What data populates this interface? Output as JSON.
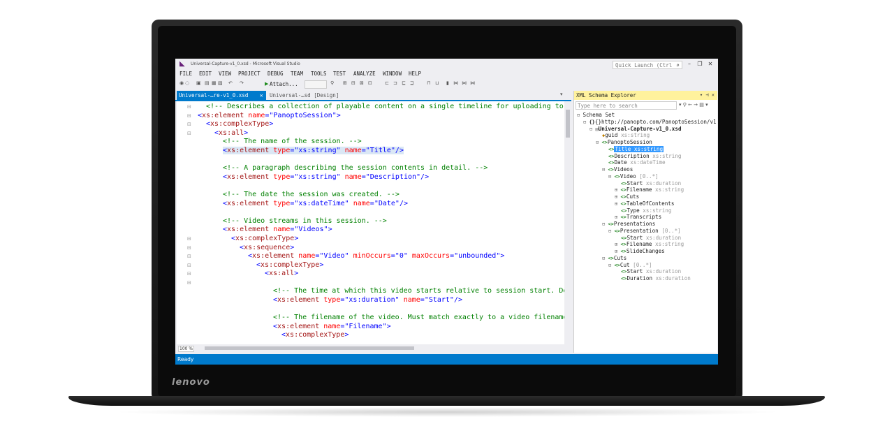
{
  "brand": {
    "logo_text": "lenovo"
  },
  "window": {
    "title": "Universal-Capture-v1_0.xsd - Microsoft Visual Studio",
    "quick_launch_placeholder": "Quick Launch (Ctrl"
  },
  "menu": [
    "FILE",
    "EDIT",
    "VIEW",
    "PROJECT",
    "DEBUG",
    "TEAM",
    "TOOLS",
    "TEST",
    "ANALYZE",
    "WINDOW",
    "HELP"
  ],
  "toolbar": {
    "attach_label": "Attach..."
  },
  "tabs": [
    {
      "label": "Universal-…re-v1_0.xsd",
      "active": true
    },
    {
      "label": "Universal-…sd [Design]",
      "active": false
    }
  ],
  "editor": {
    "zoom": "100 %",
    "lines": [
      {
        "indent": 1,
        "parts": [
          {
            "c": "comment",
            "t": "<!-- Describes a collection of playable content on a single timeline for uploading to a Pa"
          }
        ]
      },
      {
        "indent": 0,
        "parts": [
          {
            "c": "br",
            "t": "<"
          },
          {
            "c": "tag",
            "t": "xs:element"
          },
          {
            "c": "attr",
            "t": " name"
          },
          {
            "c": "br",
            "t": "="
          },
          {
            "c": "val",
            "t": "\"PanoptoSession\""
          },
          {
            "c": "br",
            "t": ">"
          }
        ]
      },
      {
        "indent": 1,
        "parts": [
          {
            "c": "br",
            "t": "<"
          },
          {
            "c": "tag",
            "t": "xs:complexType"
          },
          {
            "c": "br",
            "t": ">"
          }
        ]
      },
      {
        "indent": 2,
        "parts": [
          {
            "c": "br",
            "t": "<"
          },
          {
            "c": "tag",
            "t": "xs:all"
          },
          {
            "c": "br",
            "t": ">"
          }
        ]
      },
      {
        "indent": 3,
        "parts": [
          {
            "c": "comment",
            "t": "<!-- The name of the session. -->"
          }
        ]
      },
      {
        "indent": 3,
        "hl": true,
        "parts": [
          {
            "c": "br",
            "t": "<"
          },
          {
            "c": "tag",
            "t": "xs:element"
          },
          {
            "c": "attr",
            "t": " type"
          },
          {
            "c": "br",
            "t": "="
          },
          {
            "c": "val",
            "t": "\"xs:string\""
          },
          {
            "c": "attr",
            "t": " name"
          },
          {
            "c": "br",
            "t": "="
          },
          {
            "c": "val",
            "t": "\"Title\""
          },
          {
            "c": "br",
            "t": "/>"
          }
        ]
      },
      {
        "indent": 0,
        "parts": []
      },
      {
        "indent": 3,
        "parts": [
          {
            "c": "comment",
            "t": "<!-- A paragraph describing the session contents in detail. -->"
          }
        ]
      },
      {
        "indent": 3,
        "parts": [
          {
            "c": "br",
            "t": "<"
          },
          {
            "c": "tag",
            "t": "xs:element"
          },
          {
            "c": "attr",
            "t": " type"
          },
          {
            "c": "br",
            "t": "="
          },
          {
            "c": "val",
            "t": "\"xs:string\""
          },
          {
            "c": "attr",
            "t": " name"
          },
          {
            "c": "br",
            "t": "="
          },
          {
            "c": "val",
            "t": "\"Description\""
          },
          {
            "c": "br",
            "t": "/>"
          }
        ]
      },
      {
        "indent": 0,
        "parts": []
      },
      {
        "indent": 3,
        "parts": [
          {
            "c": "comment",
            "t": "<!-- The date the session was created. -->"
          }
        ]
      },
      {
        "indent": 3,
        "parts": [
          {
            "c": "br",
            "t": "<"
          },
          {
            "c": "tag",
            "t": "xs:element"
          },
          {
            "c": "attr",
            "t": " type"
          },
          {
            "c": "br",
            "t": "="
          },
          {
            "c": "val",
            "t": "\"xs:dateTime\""
          },
          {
            "c": "attr",
            "t": " name"
          },
          {
            "c": "br",
            "t": "="
          },
          {
            "c": "val",
            "t": "\"Date\""
          },
          {
            "c": "br",
            "t": "/>"
          }
        ]
      },
      {
        "indent": 0,
        "parts": []
      },
      {
        "indent": 3,
        "parts": [
          {
            "c": "comment",
            "t": "<!-- Video streams in this session. -->"
          }
        ]
      },
      {
        "indent": 3,
        "parts": [
          {
            "c": "br",
            "t": "<"
          },
          {
            "c": "tag",
            "t": "xs:element"
          },
          {
            "c": "attr",
            "t": " name"
          },
          {
            "c": "br",
            "t": "="
          },
          {
            "c": "val",
            "t": "\"Videos\""
          },
          {
            "c": "br",
            "t": ">"
          }
        ]
      },
      {
        "indent": 4,
        "parts": [
          {
            "c": "br",
            "t": "<"
          },
          {
            "c": "tag",
            "t": "xs:complexType"
          },
          {
            "c": "br",
            "t": ">"
          }
        ]
      },
      {
        "indent": 5,
        "parts": [
          {
            "c": "br",
            "t": "<"
          },
          {
            "c": "tag",
            "t": "xs:sequence"
          },
          {
            "c": "br",
            "t": ">"
          }
        ]
      },
      {
        "indent": 6,
        "parts": [
          {
            "c": "br",
            "t": "<"
          },
          {
            "c": "tag",
            "t": "xs:element"
          },
          {
            "c": "attr",
            "t": " name"
          },
          {
            "c": "br",
            "t": "="
          },
          {
            "c": "val",
            "t": "\"Video\""
          },
          {
            "c": "attr",
            "t": " minOccurs"
          },
          {
            "c": "br",
            "t": "="
          },
          {
            "c": "val",
            "t": "\"0\""
          },
          {
            "c": "attr",
            "t": " maxOccurs"
          },
          {
            "c": "br",
            "t": "="
          },
          {
            "c": "val",
            "t": "\"unbounded\""
          },
          {
            "c": "br",
            "t": ">"
          }
        ]
      },
      {
        "indent": 7,
        "parts": [
          {
            "c": "br",
            "t": "<"
          },
          {
            "c": "tag",
            "t": "xs:complexType"
          },
          {
            "c": "br",
            "t": ">"
          }
        ]
      },
      {
        "indent": 8,
        "parts": [
          {
            "c": "br",
            "t": "<"
          },
          {
            "c": "tag",
            "t": "xs:all"
          },
          {
            "c": "br",
            "t": ">"
          }
        ]
      },
      {
        "indent": 0,
        "parts": []
      },
      {
        "indent": 9,
        "parts": [
          {
            "c": "comment",
            "t": "<!-- The time at which this video starts relative to session start. Dete"
          }
        ]
      },
      {
        "indent": 9,
        "parts": [
          {
            "c": "br",
            "t": "<"
          },
          {
            "c": "tag",
            "t": "xs:element"
          },
          {
            "c": "attr",
            "t": " type"
          },
          {
            "c": "br",
            "t": "="
          },
          {
            "c": "val",
            "t": "\"xs:duration\""
          },
          {
            "c": "attr",
            "t": " name"
          },
          {
            "c": "br",
            "t": "="
          },
          {
            "c": "val",
            "t": "\"Start\""
          },
          {
            "c": "br",
            "t": "/>"
          }
        ]
      },
      {
        "indent": 0,
        "parts": []
      },
      {
        "indent": 9,
        "parts": [
          {
            "c": "comment",
            "t": "<!-- The filename of the video. Must match exactly to a video filename u"
          }
        ]
      },
      {
        "indent": 9,
        "parts": [
          {
            "c": "br",
            "t": "<"
          },
          {
            "c": "tag",
            "t": "xs:element"
          },
          {
            "c": "attr",
            "t": " name"
          },
          {
            "c": "br",
            "t": "="
          },
          {
            "c": "val",
            "t": "\"Filename\""
          },
          {
            "c": "br",
            "t": ">"
          }
        ]
      },
      {
        "indent": 10,
        "parts": [
          {
            "c": "br",
            "t": "<"
          },
          {
            "c": "tag",
            "t": "xs:complexType"
          },
          {
            "c": "br",
            "t": ">"
          }
        ]
      }
    ]
  },
  "schema_explorer": {
    "title": "XML Schema Explorer",
    "search_placeholder": "Type here to search",
    "tree": [
      {
        "level": 0,
        "exp": "⊟",
        "icon": "none",
        "name": "Schema Set",
        "type": ""
      },
      {
        "level": 1,
        "exp": "⊟",
        "icon": "ns",
        "name": "{}http://panopto.com/PanoptoSession/v1",
        "type": ""
      },
      {
        "level": 2,
        "exp": "⊟",
        "icon": "file",
        "name": "Universal-Capture-v1_0.xsd",
        "type": "",
        "bold": true
      },
      {
        "level": 3,
        "exp": "",
        "icon": "attr",
        "name": "guid",
        "type": "xs:string"
      },
      {
        "level": 3,
        "exp": "⊟",
        "icon": "el",
        "name": "PanoptoSession",
        "type": ""
      },
      {
        "level": 4,
        "exp": "",
        "icon": "el",
        "name": "Title",
        "type": "xs:string",
        "selected": true
      },
      {
        "level": 4,
        "exp": "",
        "icon": "el",
        "name": "Description",
        "type": "xs:string"
      },
      {
        "level": 4,
        "exp": "",
        "icon": "el",
        "name": "Date",
        "type": "xs:dateTime"
      },
      {
        "level": 4,
        "exp": "⊟",
        "icon": "el",
        "name": "Videos",
        "type": ""
      },
      {
        "level": 5,
        "exp": "⊟",
        "icon": "el",
        "name": "Video",
        "type": "[0..*]"
      },
      {
        "level": 6,
        "exp": "",
        "icon": "el",
        "name": "Start",
        "type": "xs:duration"
      },
      {
        "level": 6,
        "exp": "⊞",
        "icon": "el",
        "name": "Filename",
        "type": "xs:string",
        "attr_type": true
      },
      {
        "level": 6,
        "exp": "⊞",
        "icon": "el",
        "name": "Cuts",
        "type": ""
      },
      {
        "level": 6,
        "exp": "⊞",
        "icon": "el",
        "name": "TableOfContents",
        "type": ""
      },
      {
        "level": 6,
        "exp": "",
        "icon": "el",
        "name": "Type",
        "type": "xs:string",
        "attr_type": true
      },
      {
        "level": 6,
        "exp": "⊞",
        "icon": "el",
        "name": "Transcripts",
        "type": ""
      },
      {
        "level": 4,
        "exp": "⊟",
        "icon": "el",
        "name": "Presentations",
        "type": ""
      },
      {
        "level": 5,
        "exp": "⊟",
        "icon": "el",
        "name": "Presentation",
        "type": "[0..*]"
      },
      {
        "level": 6,
        "exp": "",
        "icon": "el",
        "name": "Start",
        "type": "xs:duration"
      },
      {
        "level": 6,
        "exp": "⊞",
        "icon": "el",
        "name": "Filename",
        "type": "xs:string"
      },
      {
        "level": 6,
        "exp": "⊞",
        "icon": "el",
        "name": "SlideChanges",
        "type": ""
      },
      {
        "level": 4,
        "exp": "⊟",
        "icon": "el",
        "name": "Cuts",
        "type": ""
      },
      {
        "level": 5,
        "exp": "⊟",
        "icon": "el",
        "name": "Cut",
        "type": "[0..*]"
      },
      {
        "level": 6,
        "exp": "",
        "icon": "el",
        "name": "Start",
        "type": "xs:duration"
      },
      {
        "level": 6,
        "exp": "",
        "icon": "el",
        "name": "Duration",
        "type": "xs:duration"
      }
    ]
  },
  "status": {
    "text": "Ready"
  },
  "colors": {
    "accent": "#007acc",
    "comment": "#008000",
    "tag": "#a31515",
    "attr": "#ff0000",
    "value": "#0000ff",
    "panel_header": "#fff29d"
  }
}
